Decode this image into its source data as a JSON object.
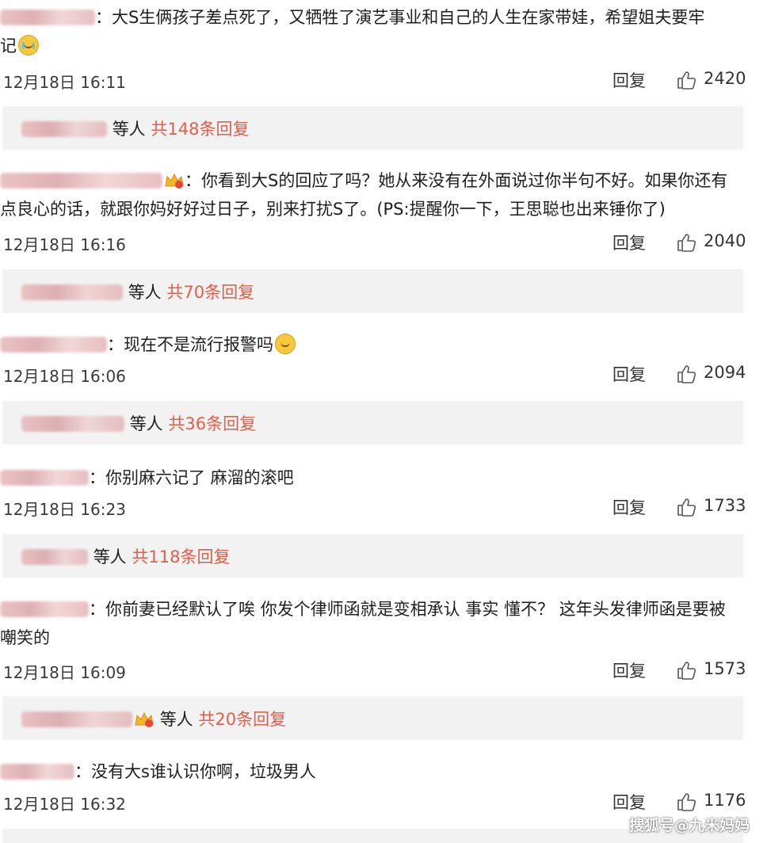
{
  "comments": [
    {
      "text_line1": "：大S生俩孩子差点死了，又牺牲了演艺事业和自己的人生在家带娃，希望姐夫要牢",
      "text_line2": "记",
      "date": "12月18日 16:11",
      "reply_label": "回复",
      "likes": "2420",
      "replies_who": "等人",
      "replies_count": "共148条回复"
    },
    {
      "text_line1": "：你看到大S的回应了吗？她从来没有在外面说过你半句不好。如果你还有",
      "text_line2": "点良心的话，就跟你妈好好过日子，别来打扰S了。(PS:提醒你一下，王思聪也出来锤你了)",
      "date": "12月18日 16:16",
      "reply_label": "回复",
      "likes": "2040",
      "replies_who": "等人",
      "replies_count": "共70条回复"
    },
    {
      "text_line1": "：现在不是流行报警吗",
      "date": "12月18日 16:06",
      "reply_label": "回复",
      "likes": "2094",
      "replies_who": "等人",
      "replies_count": "共36条回复"
    },
    {
      "text_line1": "：你别麻六记了 麻溜的滚吧",
      "date": "12月18日 16:23",
      "reply_label": "回复",
      "likes": "1733",
      "replies_who": "等人",
      "replies_count": "共118条回复"
    },
    {
      "text_line1": "：你前妻已经默认了唉 你发个律师函就是变相承认 事实 懂不？ 这年头发律师函是要被",
      "text_line2": "嘲笑的",
      "date": "12月18日 16:09",
      "reply_label": "回复",
      "likes": "1573",
      "replies_who": "等人",
      "replies_count": "共20条回复"
    },
    {
      "text_line1": "：没有大s谁认识你啊，垃圾男人",
      "date": "12月18日 16:32",
      "reply_label": "回复",
      "likes": "1176"
    }
  ],
  "watermark": "搜狐号@九米妈妈",
  "icons": {
    "like": "thumbs-up-icon",
    "emoji": "emoji-icon",
    "crown": "vip-crown-icon"
  },
  "colors": {
    "reply_count": "#e35d48",
    "reply_box_bg": "#f2f2f2"
  }
}
